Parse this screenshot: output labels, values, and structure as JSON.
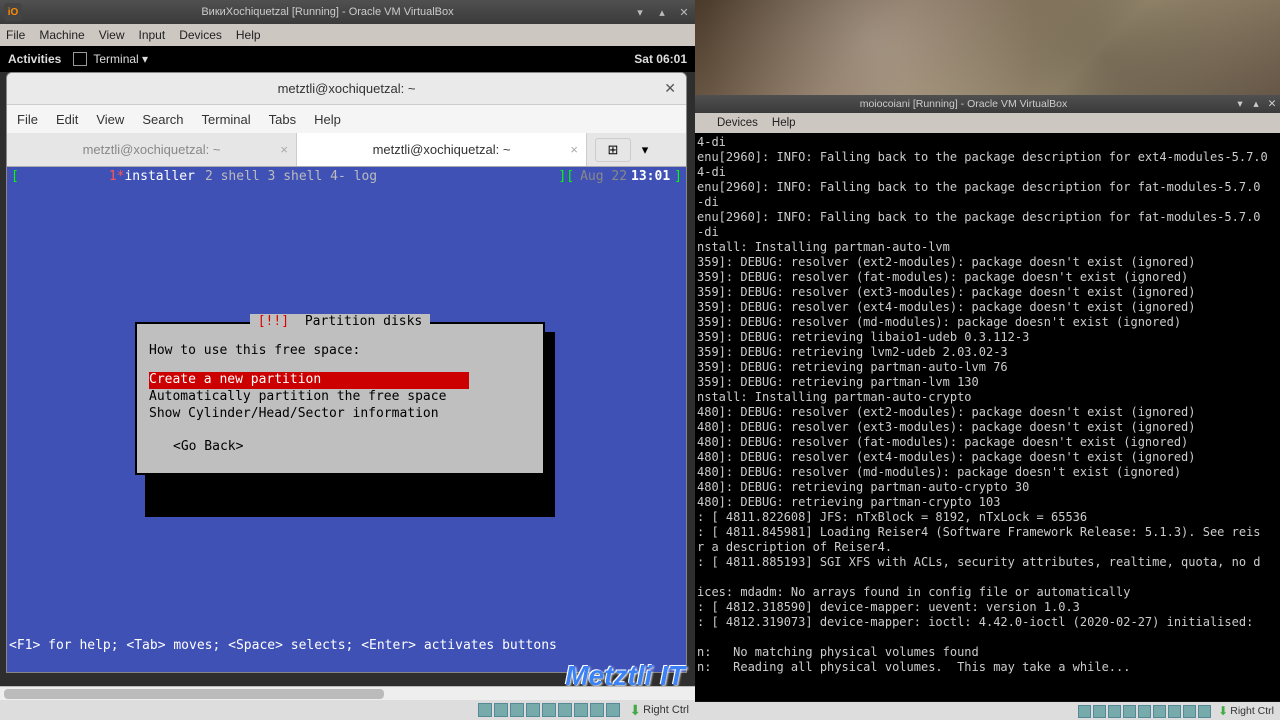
{
  "left": {
    "titlebar": "ВикиXochiquetzal [Running] - Oracle VM VirtualBox",
    "vbmenu": [
      "File",
      "Machine",
      "View",
      "Input",
      "Devices",
      "Help"
    ],
    "gnome": {
      "activities": "Activities",
      "terminal": "Terminal ▾",
      "clock": "Sat 06:01"
    },
    "termWindow": {
      "title": "metztli@xochiquetzal: ~",
      "menu": [
        "File",
        "Edit",
        "View",
        "Search",
        "Terminal",
        "Tabs",
        "Help"
      ],
      "tabs": [
        "metztli@xochiquetzal: ~",
        "metztli@xochiquetzal: ~"
      ],
      "statusLeft": {
        "star": "1*",
        "name": "installer",
        "rest": "2 shell  3 shell  4- log"
      },
      "statusRight": {
        "date": "Aug 22",
        "time": "13:01"
      },
      "dialog": {
        "title_red": "[!!]",
        "title_rest": " Partition disks ",
        "prompt": "How to use this free space:",
        "opts": [
          "Create a new partition",
          "Automatically partition the free space",
          "Show Cylinder/Head/Sector information"
        ],
        "back": "<Go Back>"
      },
      "helpLine": "<F1> for help; <Tab> moves; <Space> selects; <Enter> activates buttons"
    },
    "watermark": "Metztli IT",
    "hostkey": "Right Ctrl"
  },
  "right": {
    "titlebar": "moiocoiani [Running] - Oracle VM VirtualBox",
    "vbmenu": [
      "Devices",
      "Help"
    ],
    "hostkey": "Right Ctrl",
    "console": [
      "4-di",
      "enu[2960]: INFO: Falling back to the package description for ext4-modules-5.7.0",
      "4-di",
      "enu[2960]: INFO: Falling back to the package description for fat-modules-5.7.0",
      "-di",
      "enu[2960]: INFO: Falling back to the package description for fat-modules-5.7.0",
      "-di",
      "nstall: Installing partman-auto-lvm",
      "359]: DEBUG: resolver (ext2-modules): package doesn't exist (ignored)",
      "359]: DEBUG: resolver (fat-modules): package doesn't exist (ignored)",
      "359]: DEBUG: resolver (ext3-modules): package doesn't exist (ignored)",
      "359]: DEBUG: resolver (ext4-modules): package doesn't exist (ignored)",
      "359]: DEBUG: resolver (md-modules): package doesn't exist (ignored)",
      "359]: DEBUG: retrieving libaio1-udeb 0.3.112-3",
      "359]: DEBUG: retrieving lvm2-udeb 2.03.02-3",
      "359]: DEBUG: retrieving partman-auto-lvm 76",
      "359]: DEBUG: retrieving partman-lvm 130",
      "nstall: Installing partman-auto-crypto",
      "480]: DEBUG: resolver (ext2-modules): package doesn't exist (ignored)",
      "480]: DEBUG: resolver (ext3-modules): package doesn't exist (ignored)",
      "480]: DEBUG: resolver (fat-modules): package doesn't exist (ignored)",
      "480]: DEBUG: resolver (ext4-modules): package doesn't exist (ignored)",
      "480]: DEBUG: resolver (md-modules): package doesn't exist (ignored)",
      "480]: DEBUG: retrieving partman-auto-crypto 30",
      "480]: DEBUG: retrieving partman-crypto 103",
      ": [ 4811.822608] JFS: nTxBlock = 8192, nTxLock = 65536",
      ": [ 4811.845981] Loading Reiser4 (Software Framework Release: 5.1.3). See reis",
      "r a description of Reiser4.",
      ": [ 4811.885193] SGI XFS with ACLs, security attributes, realtime, quota, no d",
      "",
      "ices: mdadm: No arrays found in config file or automatically",
      ": [ 4812.318590] device-mapper: uevent: version 1.0.3",
      ": [ 4812.319073] device-mapper: ioctl: 4.42.0-ioctl (2020-02-27) initialised:",
      "",
      "n:   No matching physical volumes found",
      "n:   Reading all physical volumes.  This may take a while..."
    ]
  }
}
